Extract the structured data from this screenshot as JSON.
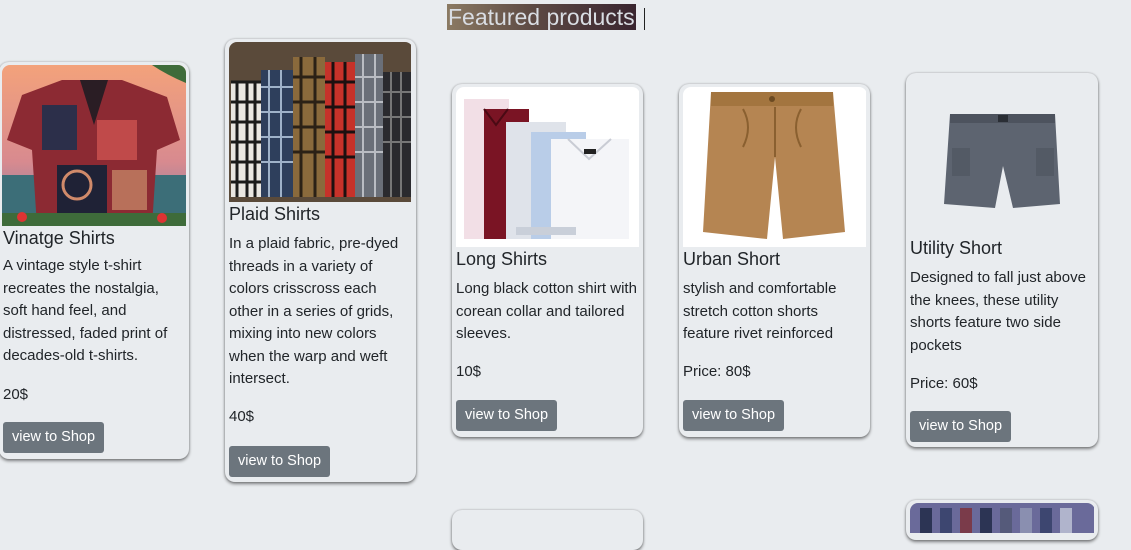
{
  "page": {
    "title": "Featured products"
  },
  "products": [
    {
      "title": "Vinatge Shirts",
      "description": "A vintage style t-shirt recreates the nostalgia, soft hand feel, and distressed, faded print of decades-old t-shirts.",
      "price": "20$",
      "button": "view to Shop",
      "image": "vintage-shirt-image"
    },
    {
      "title": "Plaid Shirts",
      "description": "In a plaid fabric, pre-dyed threads in a variety of colors crisscross each other in a series of grids, mixing into new colors when the warp and weft intersect.",
      "price": "40$",
      "button": "view to Shop",
      "image": "plaid-shirts-image"
    },
    {
      "title": "Long Shirts",
      "description": "Long black cotton shirt with corean collar and tailored sleeves.",
      "price": "10$",
      "button": "view to Shop",
      "image": "long-shirts-image"
    },
    {
      "title": "Urban Short",
      "description": "stylish and comfortable stretch cotton shorts feature rivet reinforced",
      "price": "Price: 80$",
      "button": "view to Shop",
      "image": "urban-short-image"
    },
    {
      "title": "Utility Short",
      "description": "Designed to fall just above the knees, these utility shorts feature two side pockets",
      "price": "Price: 60$",
      "button": "view to Shop",
      "image": "utility-short-image"
    }
  ]
}
